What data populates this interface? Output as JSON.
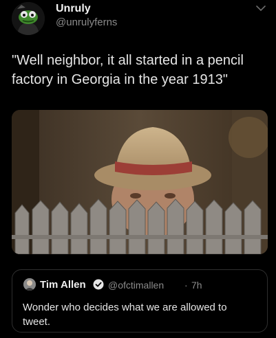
{
  "tweet": {
    "display_name": "Unruly",
    "handle": "@unrulyferns",
    "text": "\"Well neighbor, it all started in a pencil factory in Georgia in the year 1913\"",
    "avatar_icon": "frog-avatar-icon",
    "menu_icon": "chevron-down-icon"
  },
  "quoted": {
    "display_name": "Tim Allen",
    "handle": "@ofctimallen",
    "separator": "·",
    "time": "7h",
    "text": "Wonder who decides what we are allowed to tweet.",
    "verified_icon": "verified-badge-icon"
  },
  "colors": {
    "background": "#000000",
    "text": "#e6e6e6",
    "secondary": "#8b8b8b",
    "border": "#2f2f2f",
    "avatar_green": "#3f8a2c"
  }
}
